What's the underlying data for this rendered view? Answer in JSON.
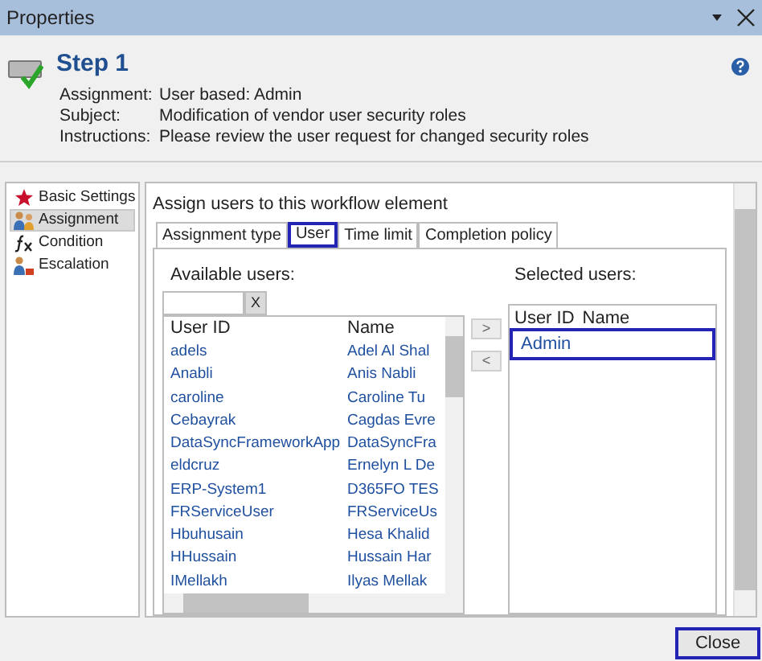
{
  "window": {
    "title": "Properties"
  },
  "header": {
    "title": "Step 1",
    "fields": [
      {
        "label": "Assignment:",
        "value": "User based: Admin"
      },
      {
        "label": "Subject:",
        "value": "Modification of vendor user security roles"
      },
      {
        "label": "Instructions:",
        "value": "Please review the user request for changed security roles"
      }
    ]
  },
  "sidebar": {
    "items": [
      {
        "label": "Basic Settings",
        "kind": "star",
        "selected": false
      },
      {
        "label": "Assignment",
        "kind": "users",
        "selected": true
      },
      {
        "label": "Condition",
        "kind": "formula",
        "selected": false
      },
      {
        "label": "Escalation",
        "kind": "escalate",
        "selected": false
      }
    ]
  },
  "panel": {
    "title": "Assign users to this workflow element",
    "tabs": [
      {
        "label": "Assignment type",
        "selected": false
      },
      {
        "label": "User",
        "selected": true
      },
      {
        "label": "Time limit",
        "selected": false
      },
      {
        "label": "Completion policy",
        "selected": false
      }
    ],
    "available": {
      "label": "Available users:",
      "clear_button": "X",
      "columns": [
        "User ID",
        "Name"
      ],
      "rows": [
        [
          "adels",
          "Adel Al Shal"
        ],
        [
          "Anabli",
          "Anis Nabli"
        ],
        [
          "caroline",
          "Caroline Tu"
        ],
        [
          "Cebayrak",
          "Cagdas Evre"
        ],
        [
          "DataSyncFrameworkApp",
          "DataSyncFra"
        ],
        [
          "eldcruz",
          "Ernelyn L De"
        ],
        [
          "ERP-System1",
          "D365FO TES"
        ],
        [
          "FRServiceUser",
          "FRServiceUs"
        ],
        [
          "Hbuhusain",
          "Hesa Khalid"
        ],
        [
          "HHussain",
          "Hussain Har"
        ],
        [
          "IMellakh",
          "Ilyas Mellak"
        ]
      ]
    },
    "move_buttons": [
      ">",
      "<"
    ],
    "selected": {
      "label": "Selected users:",
      "columns": [
        "User ID",
        "Name"
      ],
      "rows": [
        {
          "user_id": "Admin",
          "selected": true
        }
      ]
    }
  },
  "footer": {
    "close_button": "Close",
    "highlighted": true
  }
}
